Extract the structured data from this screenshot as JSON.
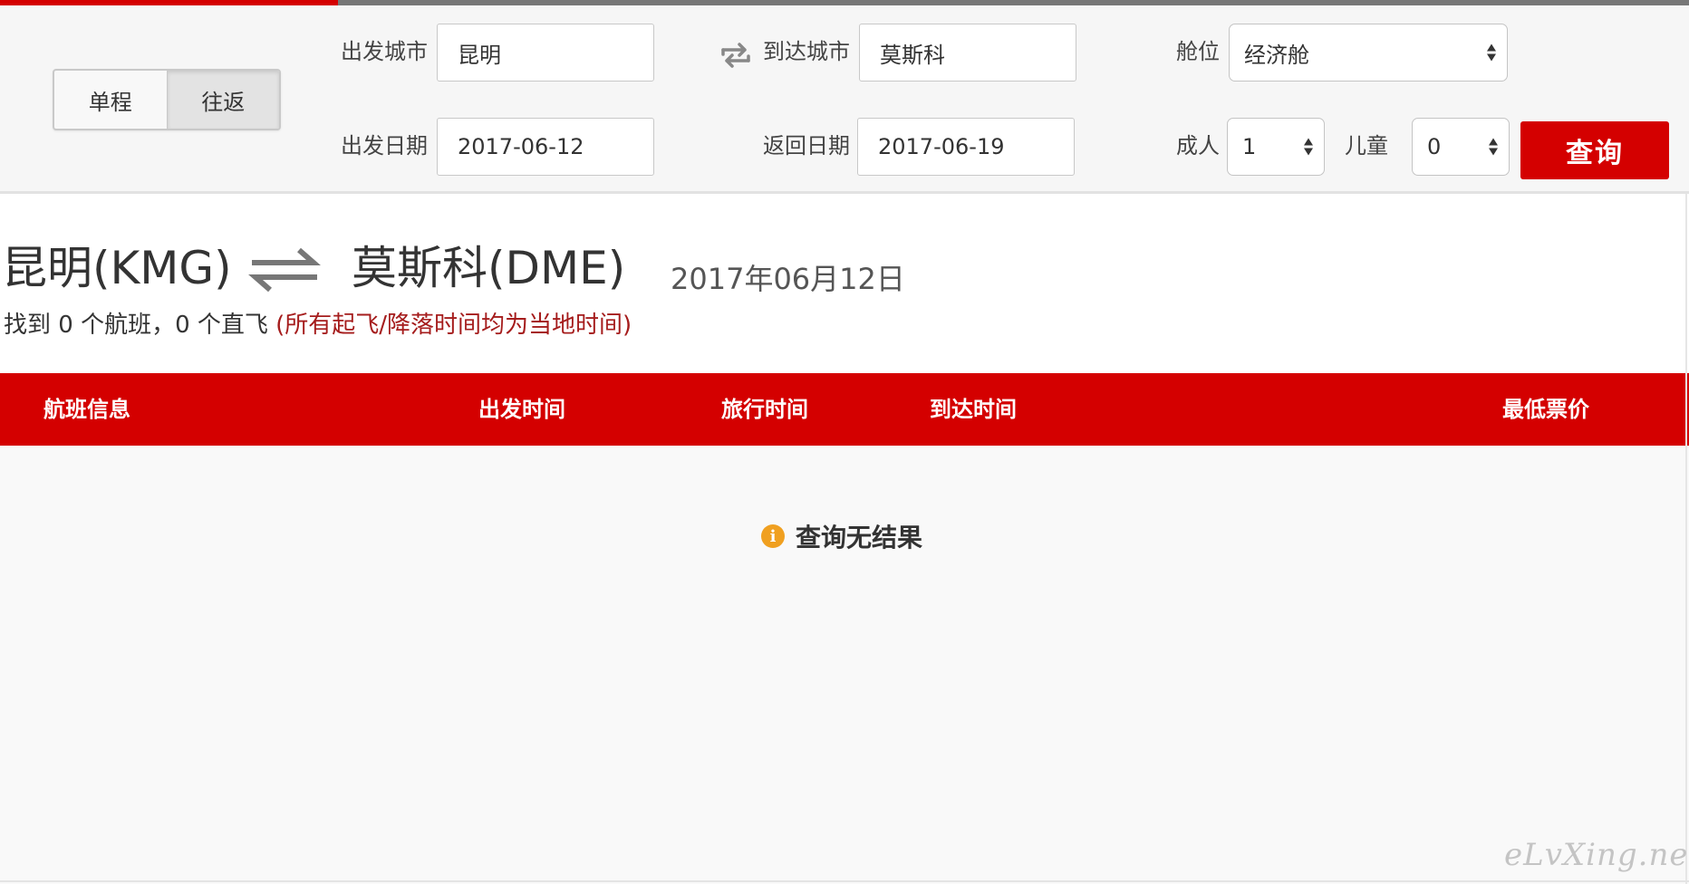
{
  "progress": {
    "fraction": 0.2,
    "color": "#d40000",
    "track_color": "#777777"
  },
  "search": {
    "trip_types": [
      {
        "label": "单程",
        "active": false
      },
      {
        "label": "往返",
        "active": true
      }
    ],
    "from_city_label": "出发城市",
    "from_city_value": "昆明",
    "swap_icon": "swap-arrows-icon",
    "to_city_label": "到达城市",
    "to_city_value": "莫斯科",
    "cabin_label": "舱位",
    "cabin_value": "经济舱",
    "depart_date_label": "出发日期",
    "depart_date_value": "2017-06-12",
    "return_date_label": "返回日期",
    "return_date_value": "2017-06-19",
    "adults_label": "成人",
    "adults_value": "1",
    "children_label": "儿童",
    "children_value": "0",
    "submit_label": "查询"
  },
  "route": {
    "origin": "昆明(KMG)",
    "destination": "莫斯科(DME)",
    "swap_icon": "round-trip-arrows-icon",
    "date": "2017年06月12日"
  },
  "summary": {
    "text": "找到 0 个航班，0 个直飞 ",
    "note": "(所有起飞/降落时间均为当地时间)"
  },
  "table": {
    "columns": [
      "航班信息",
      "出发时间",
      "旅行时间",
      "到达时间",
      "最低票价"
    ]
  },
  "empty_state": {
    "icon": "info-icon",
    "icon_glyph": "i",
    "text": "查询无结果"
  },
  "watermark": "eLvXing.net",
  "colors": {
    "accent": "#d40000",
    "note_text": "#a51c1c",
    "info_icon": "#f0a020",
    "panel_bg": "#f6f6f6"
  }
}
